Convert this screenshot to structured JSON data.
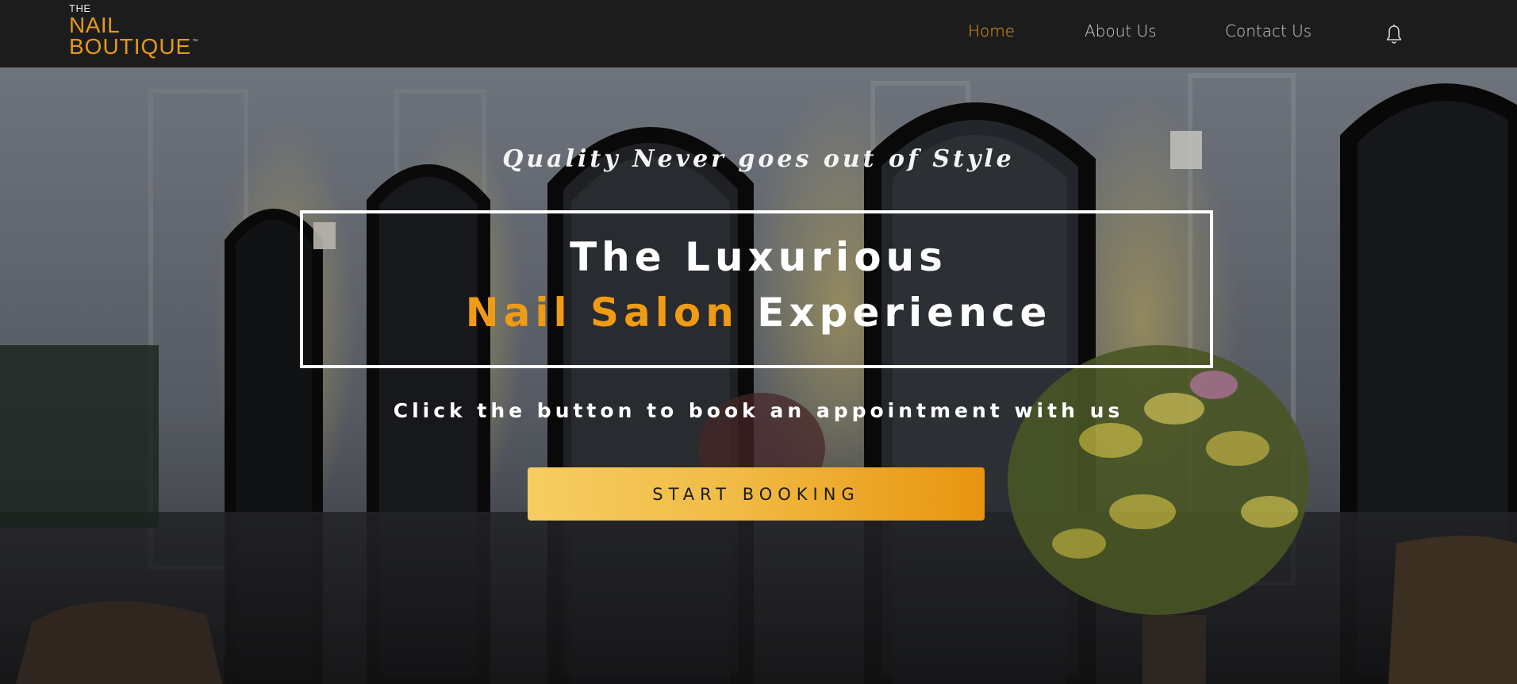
{
  "header": {
    "logo": {
      "line1": "THE",
      "line2": "NAIL",
      "line3": "BOUTIQUE",
      "trademark": "™"
    },
    "nav": [
      {
        "label": "Home",
        "active": true
      },
      {
        "label": "About Us",
        "active": false
      },
      {
        "label": "Contact Us",
        "active": false
      }
    ],
    "bell_icon": "bell-icon"
  },
  "hero": {
    "tagline": "Quality Never goes out of Style",
    "headline_line1": "The Luxurious",
    "headline_accent": "Nail Salon",
    "headline_rest": " Experience",
    "subtext": "Click the button to book an appointment with us",
    "cta_label": "START BOOKING"
  },
  "colors": {
    "accent": "#ef9b16",
    "header_bg": "#1c1c1c",
    "button_gradient_start": "#f6cd62",
    "button_gradient_end": "#e8940e"
  }
}
